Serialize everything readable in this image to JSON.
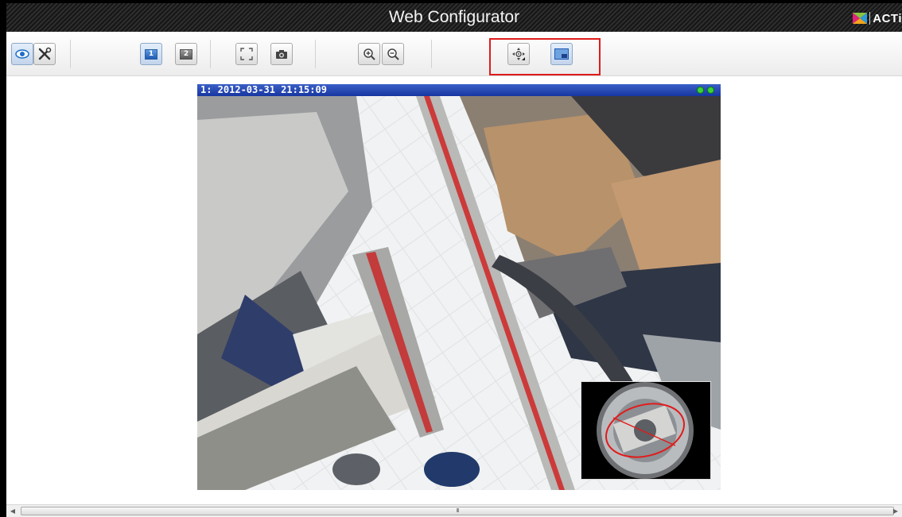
{
  "window": {
    "title": "Web Configurator",
    "brand": "ACTi"
  },
  "toolbar": {
    "view_button": {
      "icon": "eye-icon"
    },
    "setup_button": {
      "icon": "tools-icon"
    },
    "layout_1_label": "1",
    "layout_2_label": "2",
    "fullscreen_button": {
      "icon": "fullscreen-icon"
    },
    "snapshot_button": {
      "icon": "camera-icon"
    },
    "zoom_in_button": {
      "icon": "zoom-in-icon"
    },
    "zoom_out_button": {
      "icon": "zoom-out-icon"
    },
    "ptz_button": {
      "icon": "ptz-move-icon"
    },
    "pip_button": {
      "icon": "picture-in-picture-icon"
    }
  },
  "video": {
    "osd_text": "1:  2012-03-31 21:15:09",
    "status_dots": [
      "#3ad13a",
      "#3ad13a"
    ]
  },
  "colors": {
    "highlight": "#e11b1b",
    "osd_bar": "#1f3fb0",
    "titlebar": "#1c1c1c"
  },
  "scrollbar": {
    "grip": "III"
  }
}
